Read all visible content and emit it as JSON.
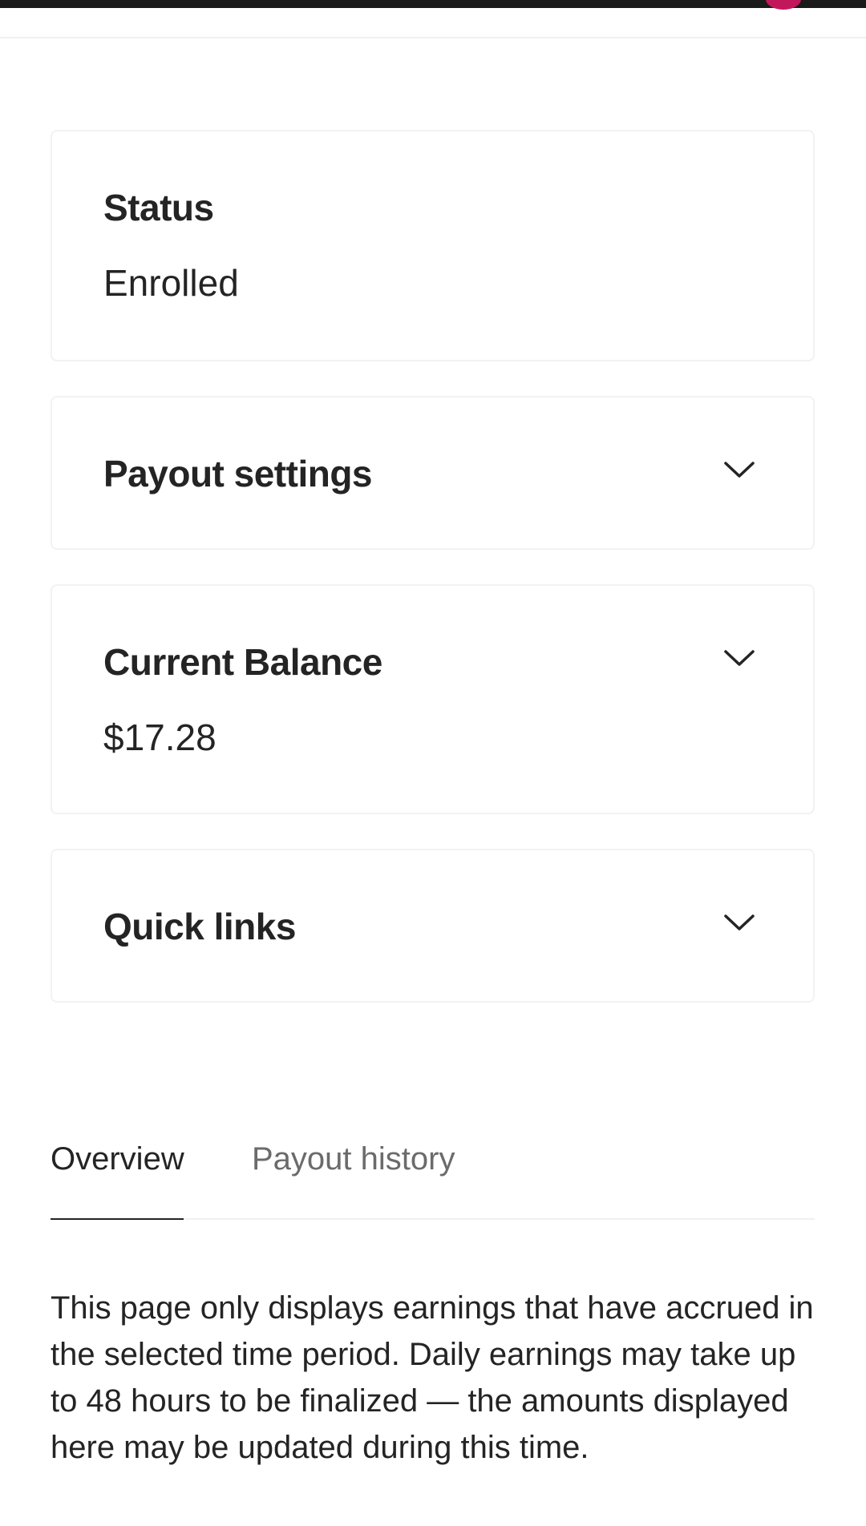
{
  "status_card": {
    "title": "Status",
    "value": "Enrolled"
  },
  "payout_settings_card": {
    "title": "Payout settings",
    "icon": "chevron-down-icon"
  },
  "current_balance_card": {
    "title": "Current Balance",
    "value": "$17.28",
    "icon": "chevron-down-icon"
  },
  "quick_links_card": {
    "title": "Quick links",
    "icon": "chevron-down-icon"
  },
  "tabs": {
    "items": [
      {
        "label": "Overview",
        "selected": true
      },
      {
        "label": "Payout history",
        "selected": false
      }
    ]
  },
  "note": "This page only displays earnings that have accrued in the selected time period. Daily earnings may take up to 48 hours to be finalized — the amounts displayed here may be updated during this time.",
  "colors": {
    "text_primary": "#242424",
    "text_secondary": "#6b6b6b",
    "border": "#f2f2f2",
    "avatar_accent": "#c2185b"
  }
}
